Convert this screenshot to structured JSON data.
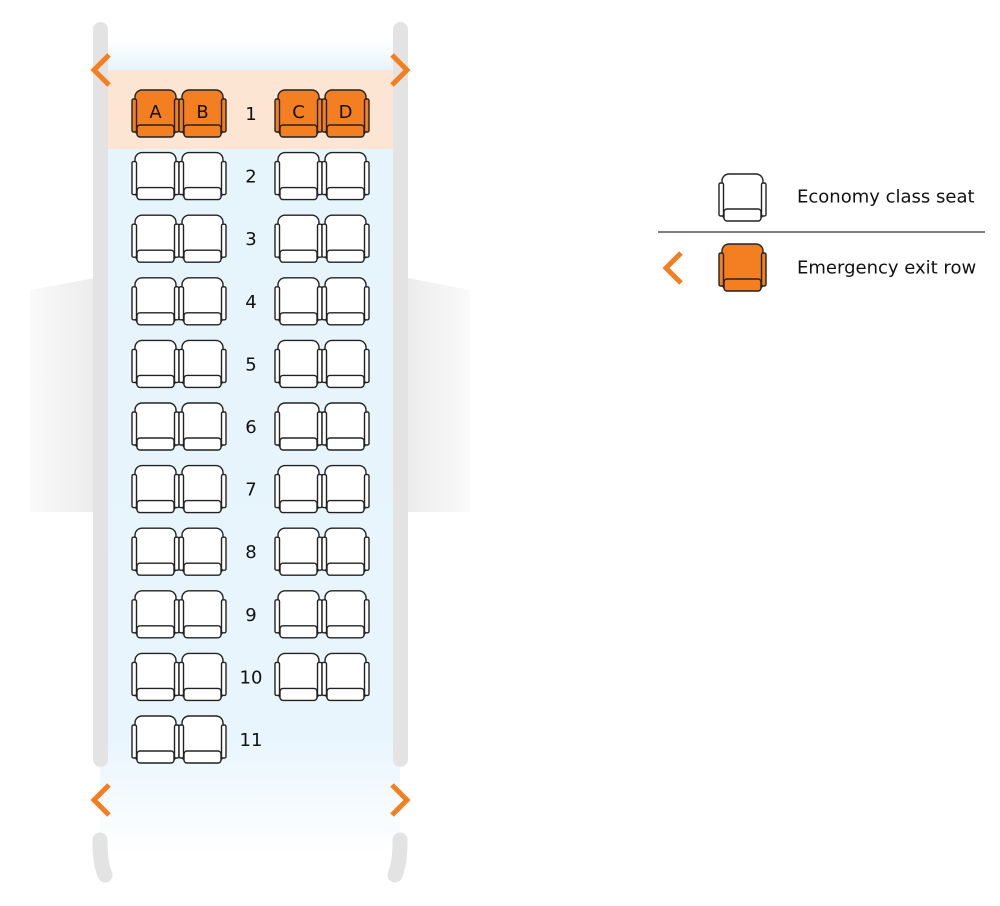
{
  "colors": {
    "exit": "#f47f20",
    "exit_band": "#fde5d4",
    "cabin": "#e3f3fc",
    "wall": "#e3e3e3",
    "seat_outline": "#222222"
  },
  "seat_map": {
    "left_columns": [
      "A",
      "B"
    ],
    "right_columns": [
      "C",
      "D"
    ],
    "rows": [
      {
        "number": "1",
        "exit": true,
        "labeled": true,
        "left": true,
        "right": true
      },
      {
        "number": "2",
        "exit": false,
        "left": true,
        "right": true
      },
      {
        "number": "3",
        "exit": false,
        "left": true,
        "right": true
      },
      {
        "number": "4",
        "exit": false,
        "left": true,
        "right": true
      },
      {
        "number": "5",
        "exit": false,
        "left": true,
        "right": true
      },
      {
        "number": "6",
        "exit": false,
        "left": true,
        "right": true
      },
      {
        "number": "7",
        "exit": false,
        "left": true,
        "right": true
      },
      {
        "number": "8",
        "exit": false,
        "left": true,
        "right": true
      },
      {
        "number": "9",
        "exit": false,
        "left": true,
        "right": true
      },
      {
        "number": "10",
        "exit": false,
        "left": true,
        "right": true
      },
      {
        "number": "11",
        "exit": false,
        "left": true,
        "right": false
      }
    ]
  },
  "legend": {
    "economy": {
      "label": "Economy class seat",
      "icon": "seat-icon"
    },
    "exit": {
      "label": "Emergency exit row",
      "icon": "exit-chevron-icon"
    }
  }
}
